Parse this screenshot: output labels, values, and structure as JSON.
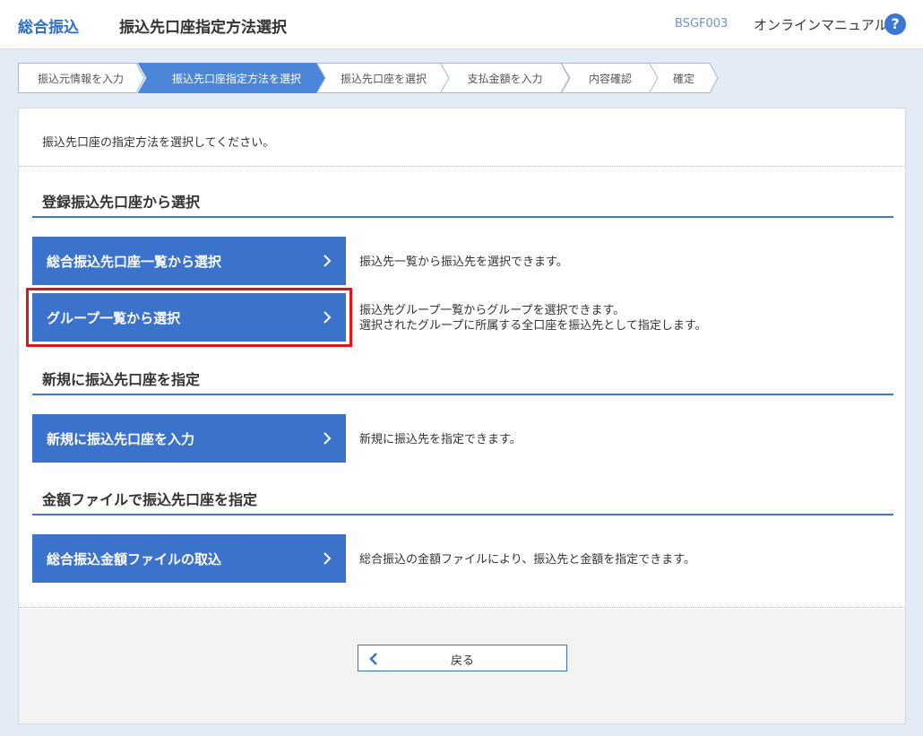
{
  "header": {
    "brand": "総合振込",
    "title": "振込先口座指定方法選択",
    "screen_id": "BSGF003",
    "manual": "オンラインマニュアル",
    "help_icon": "?"
  },
  "steps": [
    {
      "label": "振込元情報を入力",
      "active": false
    },
    {
      "label": "振込先口座指定方法を選択",
      "active": true
    },
    {
      "label": "振込先口座を選択",
      "active": false
    },
    {
      "label": "支払金額を入力",
      "active": false
    },
    {
      "label": "内容確認",
      "active": false
    },
    {
      "label": "確定",
      "active": false
    }
  ],
  "intro": "振込先口座の指定方法を選択してください。",
  "sections": {
    "registered": {
      "title": "登録振込先口座から選択",
      "list_button": "総合振込先口座一覧から選択",
      "list_desc": "振込先一覧から振込先を選択できます。",
      "group_button": "グループ一覧から選択",
      "group_desc_1": "振込先グループ一覧からグループを選択できます。",
      "group_desc_2": "選択されたグループに所属する全口座を振込先として指定します。"
    },
    "new": {
      "title": "新規に振込先口座を指定",
      "button": "新規に振込先口座を入力",
      "desc": "新規に振込先を指定できます。"
    },
    "file": {
      "title": "金額ファイルで振込先口座を指定",
      "button": "総合振込金額ファイルの取込",
      "desc": "総合振込の金額ファイルにより、振込先と金額を指定できます。"
    }
  },
  "back_button": "戻る",
  "colors": {
    "accent": "#3a72cc",
    "highlight": "#e0141b"
  }
}
